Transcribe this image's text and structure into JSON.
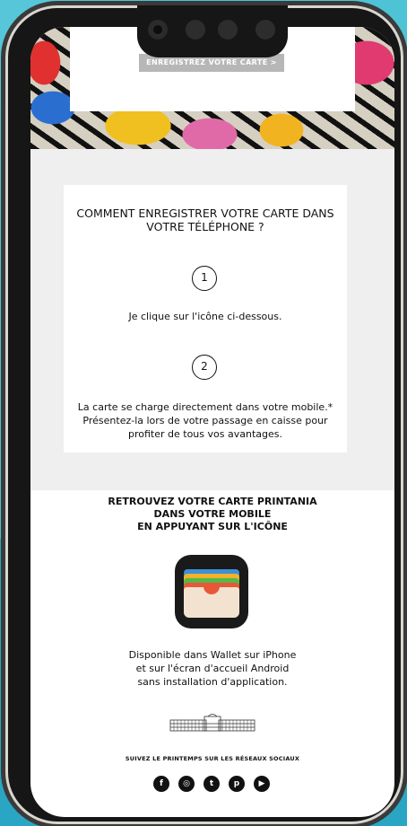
{
  "hero": {
    "cta_label": "ENREGISTREZ VOTRE CARTE >"
  },
  "instructions": {
    "title": "COMMENT ENREGISTRER VOTRE CARTE DANS VOTRE TÉLÉPHONE ?",
    "step1": {
      "number": "1",
      "text": "Je clique sur l'icône ci-dessous."
    },
    "step2": {
      "number": "2",
      "text": "La carte se charge directement dans votre mobile.* Présentez-la lors de votre passage en caisse pour profiter de tous vos avantages."
    }
  },
  "wallet": {
    "title_line1": "RETROUVEZ VOTRE CARTE PRINTANIA",
    "title_line2": "DANS VOTRE MOBILE",
    "title_line3": "EN APPUYANT SUR L'ICÔNE",
    "line1": "Disponible dans Wallet sur iPhone",
    "line2": "et sur l'écran d'accueil Android",
    "line3": "sans installation d'application."
  },
  "footer": {
    "social_label": "SUIVEZ LE PRINTEMPS SUR LES RÉSEAUX SOCIAUX",
    "socials": [
      "facebook-icon",
      "instagram-icon",
      "twitter-icon",
      "pinterest-icon",
      "youtube-icon"
    ]
  },
  "colors": {
    "background": "#4ec3d6",
    "frame": "#161616",
    "panel": "#efefef",
    "cta_grey": "#b7b7b7"
  }
}
